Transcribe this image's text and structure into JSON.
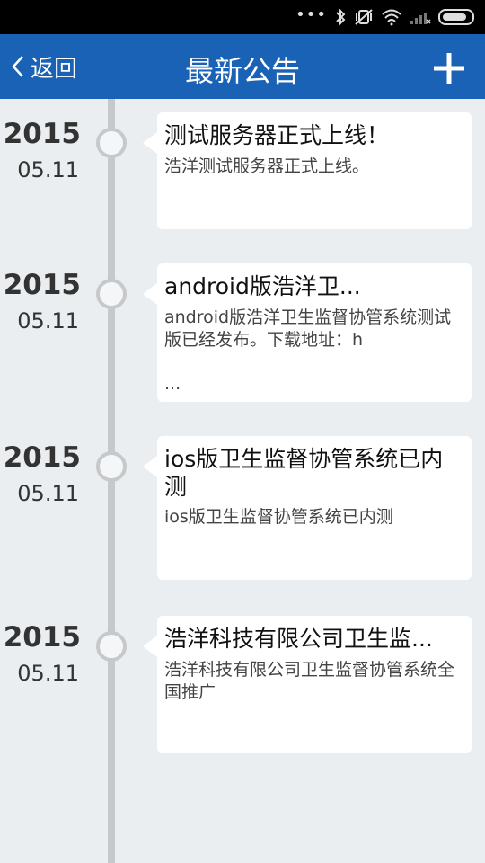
{
  "nav": {
    "back_label": "返回",
    "title": "最新公告"
  },
  "announcements": [
    {
      "year": "2015",
      "date": "05.11",
      "title": "测试服务器正式上线！",
      "body": "浩洋测试服务器正式上线。",
      "ellipsis": ""
    },
    {
      "year": "2015",
      "date": "05.11",
      "title": "android版浩洋卫...",
      "body": "android版浩洋卫生监督协管系统测试版已经发布。下载地址：h",
      "ellipsis": "..."
    },
    {
      "year": "2015",
      "date": "05.11",
      "title": "ios版卫生监督协管系统已内测",
      "body": "ios版卫生监督协管系统已内测",
      "ellipsis": ""
    },
    {
      "year": "2015",
      "date": "05.11",
      "title": "浩洋科技有限公司卫生监...",
      "body": "浩洋科技有限公司卫生监督协管系统全国推广",
      "ellipsis": ""
    }
  ]
}
